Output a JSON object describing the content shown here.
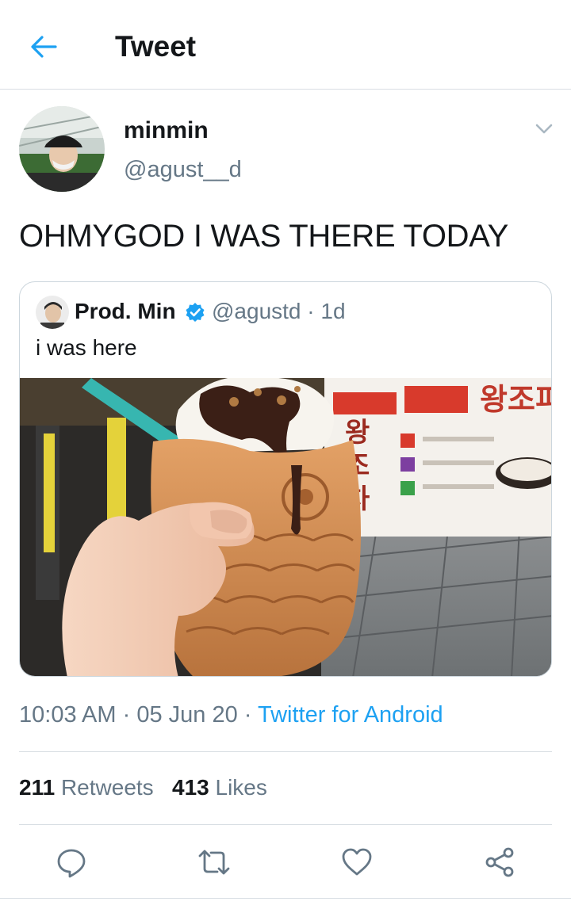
{
  "header": {
    "title": "Tweet",
    "back_icon": "arrow-left-icon"
  },
  "tweet": {
    "author": {
      "name": "minmin",
      "handle": "@agust__d"
    },
    "text": "OHMYGOD I WAS THERE TODAY",
    "time": "10:03 AM",
    "date": "05 Jun 20",
    "source": "Twitter for Android",
    "retweets_count": "211",
    "retweets_label": "Retweets",
    "likes_count": "413",
    "likes_label": "Likes"
  },
  "quoted_tweet": {
    "name": "Prod. Min",
    "handle": "@agustd",
    "age": "1d",
    "text": "i was here"
  },
  "actions": [
    "reply-icon",
    "retweet-icon",
    "like-icon",
    "share-icon"
  ],
  "colors": {
    "accent": "#1da1f2",
    "text": "#14171a",
    "secondary": "#657786",
    "border": "#d8dee3"
  }
}
